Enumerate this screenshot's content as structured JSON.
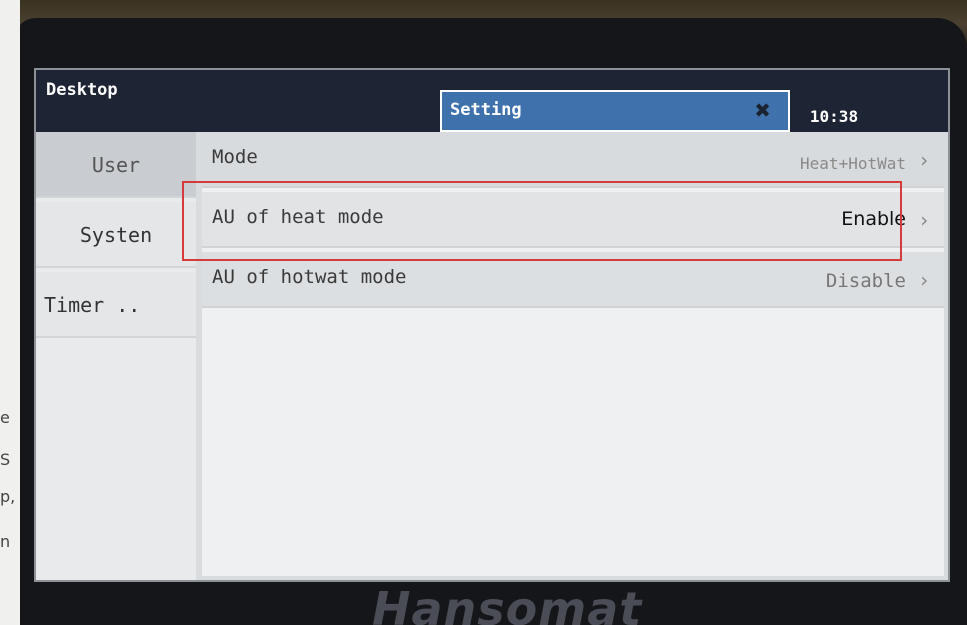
{
  "topbar": {
    "desktop_title": "Desktop",
    "setting_title": "Setting",
    "clock": "10:38"
  },
  "sidebar": {
    "items": [
      {
        "label": "User",
        "active": true
      },
      {
        "label": "Systen",
        "active": false
      },
      {
        "label": "Timer ..",
        "active": false
      }
    ]
  },
  "settings": {
    "rows": [
      {
        "label": "Mode",
        "value": "Heat+HotWat"
      },
      {
        "label": "AU of heat mode",
        "value": "Enable"
      },
      {
        "label": "AU of hotwat mode",
        "value": "Disable"
      }
    ]
  },
  "device": {
    "brand": "Hansomat"
  },
  "left_strip": {
    "fragments": [
      "e",
      "S",
      "p,",
      "n"
    ]
  },
  "colors": {
    "topbar": "#1d2535",
    "setting_tab": "#3f72ad",
    "highlight": "#d63a3a"
  }
}
